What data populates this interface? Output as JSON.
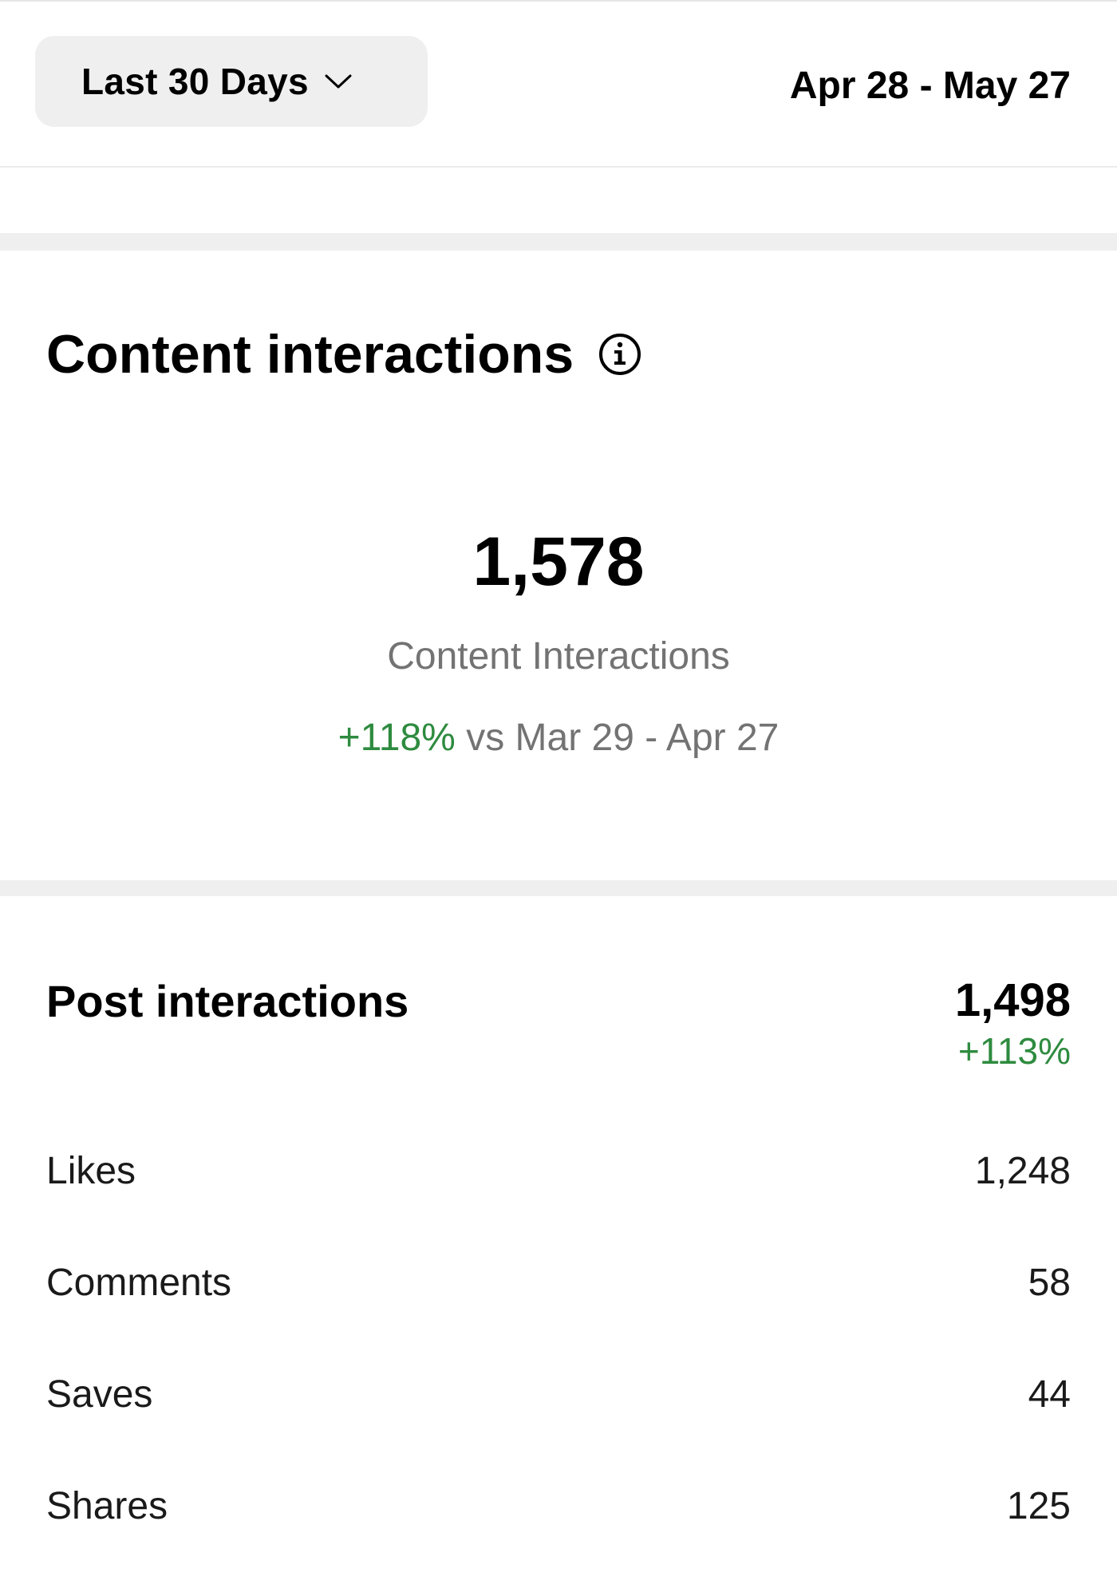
{
  "header": {
    "range_label": "Last 30 Days",
    "date_range": "Apr 28 - May 27"
  },
  "content_interactions": {
    "title": "Content interactions",
    "total": "1,578",
    "label": "Content Interactions",
    "change": "+118%",
    "comparison": " vs Mar 29 - Apr 27"
  },
  "post_interactions": {
    "title": "Post interactions",
    "total": "1,498",
    "change": "+113%",
    "rows": [
      {
        "label": "Likes",
        "value": "1,248"
      },
      {
        "label": "Comments",
        "value": "58"
      },
      {
        "label": "Saves",
        "value": "44"
      },
      {
        "label": "Shares",
        "value": "125"
      }
    ]
  },
  "colors": {
    "positive": "#2e8b3f",
    "muted_text": "#737373",
    "dropdown_bg": "#efefef"
  },
  "icons": {
    "dropdown": "chevron-down-icon",
    "info": "info-icon"
  }
}
